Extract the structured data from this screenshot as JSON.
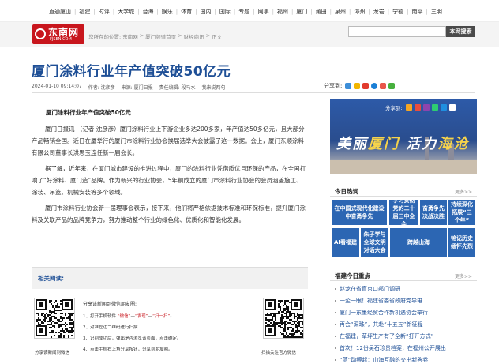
{
  "top_nav": [
    "直通厦山",
    "福建",
    "时评",
    "大学城",
    "台海",
    "娱乐",
    "体育",
    "国内",
    "国际",
    "专题",
    "网事",
    "福州",
    "厦门",
    "莆田",
    "泉州",
    "漳州",
    "龙岩",
    "宁德",
    "南平",
    "三明"
  ],
  "logo": {
    "text": "东南网",
    "sub": "FJSEN.COM"
  },
  "breadcrumb": [
    "您所在的位置:",
    "东南网",
    ">",
    "厦门频道首页",
    ">",
    "财经商讯",
    ">",
    "正文"
  ],
  "search": {
    "value": "",
    "button": "本网搜索"
  },
  "article": {
    "title": "厦门涂料行业年产值突破50亿元",
    "meta": [
      "2024-01-10 09:14:07",
      "作者: 沈彦彦",
      "来源: 厦门日报",
      "责任编辑: 段马水",
      "我来说两句"
    ],
    "share_label": "分享到:",
    "lead": "厦门涂料行业年产值突破50亿元",
    "paragraphs": [
      "厦门日报讯 （记者 沈彦彦）厦门涂料行业上下游企业多达200多家，年产值达50多亿元，且大部分产品畅销全国。近日在厦举行的厦门市涂料行业协会换届选举大会披露了这一数据。会上，厦门东顺涂料有限公司董事长洪思玉连任新一届会长。",
      "据了解，近年来，在厦门城市建设的推进过程中，厦门的涂料行业凭借质优且环保的产品，在全国打响了“好涂料、厦门造”品牌。作为新兴的行业协会，5年前成立的厦门市涂料行业协会的会员涵盖施工、涂装、吊篮、机械安装等多个领域。",
      "厦门市涂料行业协会新一届理事会表示，接下来，他们将严格依据技术标准和环保标准，提升厦门涂料及关联产品的品牌竞争力，努力推动整个行业的绿色化、优质化和智能化发展。"
    ]
  },
  "related": {
    "label": "相关阅读:"
  },
  "promo": {
    "title": "分享该新闻到微信朋友圈:",
    "steps": [
      [
        "1、打开手机软件 ",
        "“微信”",
        "—",
        "“发现”",
        "—",
        "“扫一扫”",
        "。"
      ],
      [
        "2、对准左边二维码进行扫描",
        "",
        "",
        "",
        "",
        "",
        ""
      ],
      [
        "3、识别成功后，弹出是否浏览该页面，点击确定。",
        "",
        "",
        "",
        "",
        "",
        ""
      ],
      [
        "4、点击手机右上角分享按钮，分享到朋友圈。",
        "",
        "",
        "",
        "",
        "",
        ""
      ]
    ],
    "qr_left_caption": "分享该新闻到微信",
    "qr_right_caption": "扫描关注官方微信"
  },
  "banner": {
    "share_label": "分享到:",
    "slogan_a": "美丽",
    "slogan_b": "厦门",
    "slogan_c": "活力",
    "slogan_d": "海沧"
  },
  "hot": {
    "title": "今日热词",
    "more": "更多>>",
    "tiles": [
      "在中国式现代化建设中奋勇争先",
      "学习贯彻党的二十届三中全会",
      "奋勇争先决战决胜",
      "持续深化拓展“三个年”",
      "AI看福建",
      "朱子学与全球文明对话大会",
      "跨越山海",
      "铭记历史缅怀先烈"
    ]
  },
  "fujian": {
    "title": "福建今日重点",
    "more": "更多>>",
    "items": [
      "赵龙在省直京口部门调研",
      "一企一眼！福建省委省政府党导电",
      "厦门一东墨经贸合作新机遇协会举行",
      "再会“深珠”，共赴“十五五”新征程",
      "在福建，草坪生产有了全新“打开方式”",
      "首次！12份吴石珍贵档案，在福州公开展出",
      "“蓝”动缚起：山海互融的交出新答卷"
    ]
  },
  "colors": {
    "brand_red": "#c8161d",
    "title_blue": "#1e4f96",
    "tile_blue": "#2c66b3"
  }
}
